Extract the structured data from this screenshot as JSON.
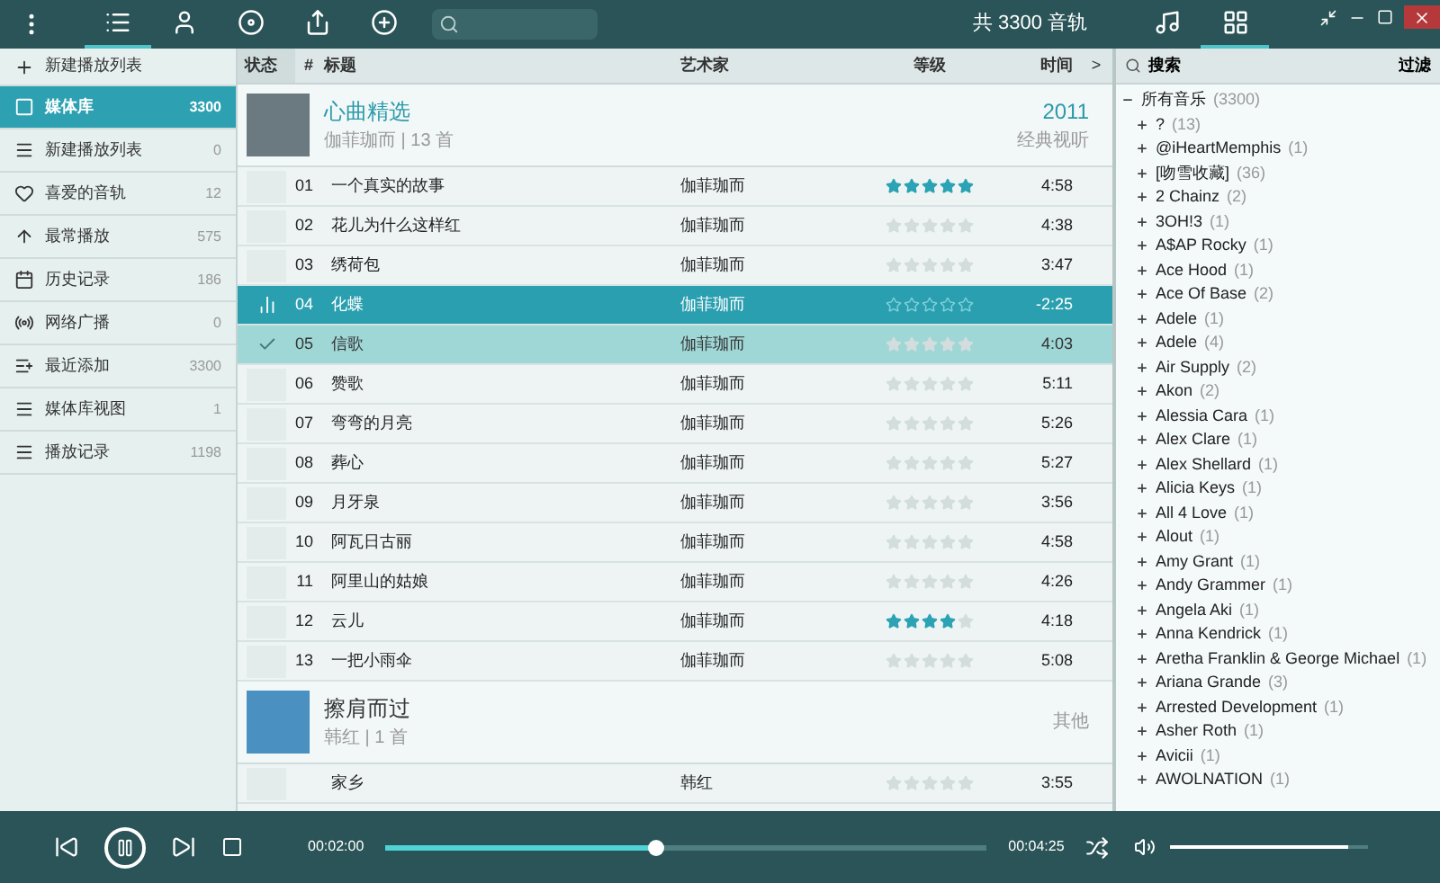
{
  "toolbar": {
    "tabs": [
      {
        "selected": true
      },
      {
        "selected": false
      },
      {
        "selected": false
      },
      {
        "selected": false
      },
      {
        "selected": false
      }
    ],
    "track_total": "共 3300 音轨",
    "view_tabs": [
      {
        "selected": false
      },
      {
        "selected": true
      }
    ]
  },
  "sidebar": [
    {
      "kind": "action",
      "label": "新建播放列表",
      "selected": false
    },
    {
      "kind": "item",
      "label": "媒体库",
      "count": "3300",
      "selected": true
    },
    {
      "kind": "item",
      "label": "新建播放列表",
      "count": "0",
      "selected": false
    },
    {
      "kind": "item",
      "label": "喜爱的音轨",
      "count": "12",
      "selected": false
    },
    {
      "kind": "item",
      "label": "最常播放",
      "count": "575",
      "selected": false
    },
    {
      "kind": "item",
      "label": "历史记录",
      "count": "186",
      "selected": false
    },
    {
      "kind": "item",
      "label": "网络广播",
      "count": "0",
      "selected": false
    },
    {
      "kind": "item",
      "label": "最近添加",
      "count": "3300",
      "selected": false
    },
    {
      "kind": "item",
      "label": "媒体库视图",
      "count": "1",
      "selected": false
    },
    {
      "kind": "item",
      "label": "播放记录",
      "count": "1198",
      "selected": false
    }
  ],
  "columns": [
    "状态",
    "#",
    "标题",
    "艺术家",
    "等级",
    "时间",
    ">"
  ],
  "albums": [
    {
      "title": "心曲精选",
      "subtitle": "伽菲珈而 | 13 首",
      "year": "2011",
      "genre": "经典视听",
      "tracks": [
        {
          "number": "01",
          "title": "一个真实的故事",
          "artist": "伽菲珈而",
          "stars": 5,
          "time": "4:58",
          "playing": false,
          "selected": false
        },
        {
          "number": "02",
          "title": "花儿为什么这样红",
          "artist": "伽菲珈而",
          "stars": 0,
          "time": "4:38",
          "playing": false,
          "selected": false
        },
        {
          "number": "03",
          "title": "绣荷包",
          "artist": "伽菲珈而",
          "stars": 0,
          "time": "3:47",
          "playing": false,
          "selected": false
        },
        {
          "number": "04",
          "title": "化蝶",
          "artist": "伽菲珈而",
          "stars": 0,
          "time": "-2:25",
          "playing": true,
          "selected": false
        },
        {
          "number": "05",
          "title": "信歌",
          "artist": "伽菲珈而",
          "stars": 0,
          "time": "4:03",
          "playing": false,
          "selected": true
        },
        {
          "number": "06",
          "title": "赞歌",
          "artist": "伽菲珈而",
          "stars": 0,
          "time": "5:11",
          "playing": false,
          "selected": false
        },
        {
          "number": "07",
          "title": "弯弯的月亮",
          "artist": "伽菲珈而",
          "stars": 0,
          "time": "5:26",
          "playing": false,
          "selected": false
        },
        {
          "number": "08",
          "title": "葬心",
          "artist": "伽菲珈而",
          "stars": 0,
          "time": "5:27",
          "playing": false,
          "selected": false
        },
        {
          "number": "09",
          "title": "月牙泉",
          "artist": "伽菲珈而",
          "stars": 0,
          "time": "3:56",
          "playing": false,
          "selected": false
        },
        {
          "number": "10",
          "title": "阿瓦日古丽",
          "artist": "伽菲珈而",
          "stars": 0,
          "time": "4:58",
          "playing": false,
          "selected": false
        },
        {
          "number": "11",
          "title": "阿里山的姑娘",
          "artist": "伽菲珈而",
          "stars": 0,
          "time": "4:26",
          "playing": false,
          "selected": false
        },
        {
          "number": "12",
          "title": "云儿",
          "artist": "伽菲珈而",
          "stars": 4,
          "time": "4:18",
          "playing": false,
          "selected": false
        },
        {
          "number": "13",
          "title": "一把小雨伞",
          "artist": "伽菲珈而",
          "stars": 0,
          "time": "5:08",
          "playing": false,
          "selected": false
        }
      ]
    },
    {
      "title": "擦肩而过",
      "subtitle": "韩红 | 1 首",
      "genre": "其他",
      "tracks": [
        {
          "title": "家乡",
          "artist": "韩红",
          "stars": 0,
          "time": "3:55",
          "playing": false,
          "selected": false
        }
      ]
    }
  ],
  "filter_panel": {
    "search_label": "搜索",
    "filter_label": "过滤",
    "tree": [
      {
        "label": "所有音乐",
        "count": "(3300)",
        "expanded": true,
        "children": [
          {
            "label": "?",
            "count": "(13)",
            "expanded": false
          },
          {
            "label": "@iHeartMemphis",
            "count": "(1)",
            "expanded": false
          },
          {
            "label": "[吻雪收藏]",
            "count": "(36)",
            "expanded": false
          },
          {
            "label": "2 Chainz",
            "count": "(2)",
            "expanded": false
          },
          {
            "label": "3OH!3",
            "count": "(1)",
            "expanded": false
          },
          {
            "label": "A$AP Rocky",
            "count": "(1)",
            "expanded": false
          },
          {
            "label": "Ace Hood",
            "count": "(1)",
            "expanded": false
          },
          {
            "label": "Ace Of Base",
            "count": "(2)",
            "expanded": false
          },
          {
            "label": "Adele",
            "count": "(1)",
            "expanded": false
          },
          {
            "label": "Adele",
            "count": "(4)",
            "expanded": false
          },
          {
            "label": "Air Supply",
            "count": "(2)",
            "expanded": false
          },
          {
            "label": "Akon",
            "count": "(2)",
            "expanded": false
          },
          {
            "label": "Alessia Cara",
            "count": "(1)",
            "expanded": false
          },
          {
            "label": "Alex Clare",
            "count": "(1)",
            "expanded": false
          },
          {
            "label": "Alex Shellard",
            "count": "(1)",
            "expanded": false
          },
          {
            "label": "Alicia Keys",
            "count": "(1)",
            "expanded": false
          },
          {
            "label": "All 4 Love",
            "count": "(1)",
            "expanded": false
          },
          {
            "label": "Alout",
            "count": "(1)",
            "expanded": false
          },
          {
            "label": "Amy Grant",
            "count": "(1)",
            "expanded": false
          },
          {
            "label": "Andy Grammer",
            "count": "(1)",
            "expanded": false
          },
          {
            "label": "Angela Aki",
            "count": "(1)",
            "expanded": false
          },
          {
            "label": "Anna Kendrick",
            "count": "(1)",
            "expanded": false
          },
          {
            "label": "Aretha Franklin & George Michael",
            "count": "(1)",
            "expanded": false
          },
          {
            "label": "Ariana Grande",
            "count": "(3)",
            "expanded": false
          },
          {
            "label": "Arrested Development",
            "count": "(1)",
            "expanded": false
          },
          {
            "label": "Asher Roth",
            "count": "(1)",
            "expanded": false
          },
          {
            "label": "Avicii",
            "count": "(1)",
            "expanded": false
          },
          {
            "label": "AWOLNATION",
            "count": "(1)",
            "expanded": false
          }
        ]
      }
    ]
  },
  "player": {
    "elapsed": "00:02:00",
    "total": "00:04:25",
    "progress": {
      "level": 0.45
    },
    "volume": {
      "level": 0.9
    },
    "playing": true
  }
}
